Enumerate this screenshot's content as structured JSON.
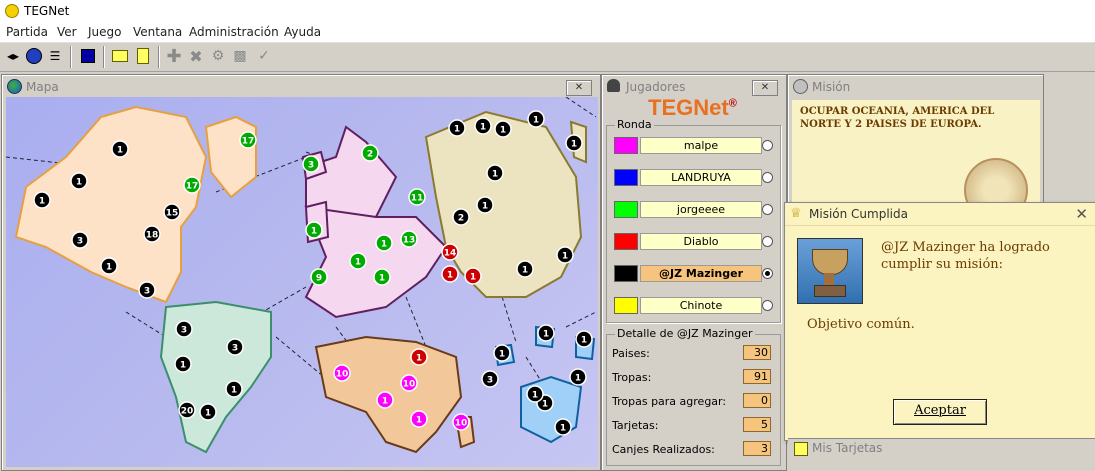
{
  "app": {
    "title": "TEGNet"
  },
  "menu": [
    "Partida",
    "Ver",
    "Juego",
    "Ventana",
    "Administración",
    "Ayuda"
  ],
  "map_window": {
    "title": "Mapa",
    "close": "☒"
  },
  "players_window": {
    "title": "Jugadores",
    "logo_main": "TEGNet",
    "logo_mark": "®",
    "round_label": "Ronda",
    "players": [
      {
        "name": "malpe",
        "color": "#ff00ff",
        "selected": false
      },
      {
        "name": "LANDRUYA",
        "color": "#0000ff",
        "selected": false
      },
      {
        "name": "jorgeeee",
        "color": "#00ff00",
        "selected": false
      },
      {
        "name": "Diablo",
        "color": "#ff0000",
        "selected": false
      },
      {
        "name": "@JZ Mazinger",
        "color": "#000000",
        "selected": true
      },
      {
        "name": "Chinote",
        "color": "#ffff00",
        "selected": false
      }
    ],
    "detail_label": "Detalle de @JZ Mazinger",
    "details": [
      {
        "key": "Paises:",
        "value": "30"
      },
      {
        "key": "Tropas:",
        "value": "91"
      },
      {
        "key": "Tropas para agregar:",
        "value": "0"
      },
      {
        "key": "Tarjetas:",
        "value": "5"
      },
      {
        "key": "Canjes Realizados:",
        "value": "3"
      }
    ]
  },
  "mission_window": {
    "title": "Misión",
    "text": "OCUPAR OCEANIA, AMERICA DEL NORTE Y 2 PAISES DE EUROPA."
  },
  "dialog": {
    "title": "Misión Cumplida",
    "message": "@JZ Mazinger ha logrado cumplir su misión:",
    "sub": "Objetivo común.",
    "ok": "Aceptar"
  },
  "cards_window": {
    "title": "Mis Tarjetas"
  },
  "map_armies": [
    {
      "n": "1",
      "c": "#000000"
    },
    {
      "n": "1",
      "c": "#000000"
    },
    {
      "n": "1",
      "c": "#000000"
    },
    {
      "n": "3",
      "c": "#000000"
    },
    {
      "n": "1",
      "c": "#000000"
    },
    {
      "n": "3",
      "c": "#000000"
    },
    {
      "n": "15",
      "c": "#000000"
    },
    {
      "n": "18",
      "c": "#000000"
    },
    {
      "n": "17",
      "c": "#00aa00"
    },
    {
      "n": "17",
      "c": "#00aa00"
    },
    {
      "n": "3",
      "c": "#00aa00"
    },
    {
      "n": "2",
      "c": "#00aa00"
    },
    {
      "n": "11",
      "c": "#00aa00"
    },
    {
      "n": "1",
      "c": "#00aa00"
    },
    {
      "n": "1",
      "c": "#00aa00"
    },
    {
      "n": "13",
      "c": "#00aa00"
    },
    {
      "n": "1",
      "c": "#00aa00"
    },
    {
      "n": "9",
      "c": "#00aa00"
    },
    {
      "n": "1",
      "c": "#00aa00"
    },
    {
      "n": "2",
      "c": "#000000"
    },
    {
      "n": "14",
      "c": "#cc0000"
    },
    {
      "n": "1",
      "c": "#cc0000"
    },
    {
      "n": "1",
      "c": "#cc0000"
    },
    {
      "n": "1",
      "c": "#000000"
    },
    {
      "n": "1",
      "c": "#000000"
    },
    {
      "n": "1",
      "c": "#000000"
    },
    {
      "n": "1",
      "c": "#000000"
    },
    {
      "n": "1",
      "c": "#000000"
    },
    {
      "n": "1",
      "c": "#000000"
    },
    {
      "n": "1",
      "c": "#000000"
    },
    {
      "n": "1",
      "c": "#000000"
    },
    {
      "n": "1",
      "c": "#000000"
    },
    {
      "n": "3",
      "c": "#000000"
    },
    {
      "n": "1",
      "c": "#000000"
    },
    {
      "n": "3",
      "c": "#000000"
    },
    {
      "n": "1",
      "c": "#000000"
    },
    {
      "n": "20",
      "c": "#000000"
    },
    {
      "n": "1",
      "c": "#000000"
    },
    {
      "n": "1",
      "c": "#000000"
    },
    {
      "n": "1",
      "c": "#000000"
    },
    {
      "n": "1",
      "c": "#000000"
    },
    {
      "n": "10",
      "c": "#ff00ff"
    },
    {
      "n": "1",
      "c": "#cc0000"
    },
    {
      "n": "10",
      "c": "#ff00ff"
    },
    {
      "n": "1",
      "c": "#ff00ff"
    },
    {
      "n": "1",
      "c": "#ff00ff"
    },
    {
      "n": "10",
      "c": "#ff00ff"
    },
    {
      "n": "1",
      "c": "#000000"
    },
    {
      "n": "1",
      "c": "#000000"
    },
    {
      "n": "3",
      "c": "#000000"
    },
    {
      "n": "1",
      "c": "#000000"
    },
    {
      "n": "1",
      "c": "#000000"
    }
  ]
}
